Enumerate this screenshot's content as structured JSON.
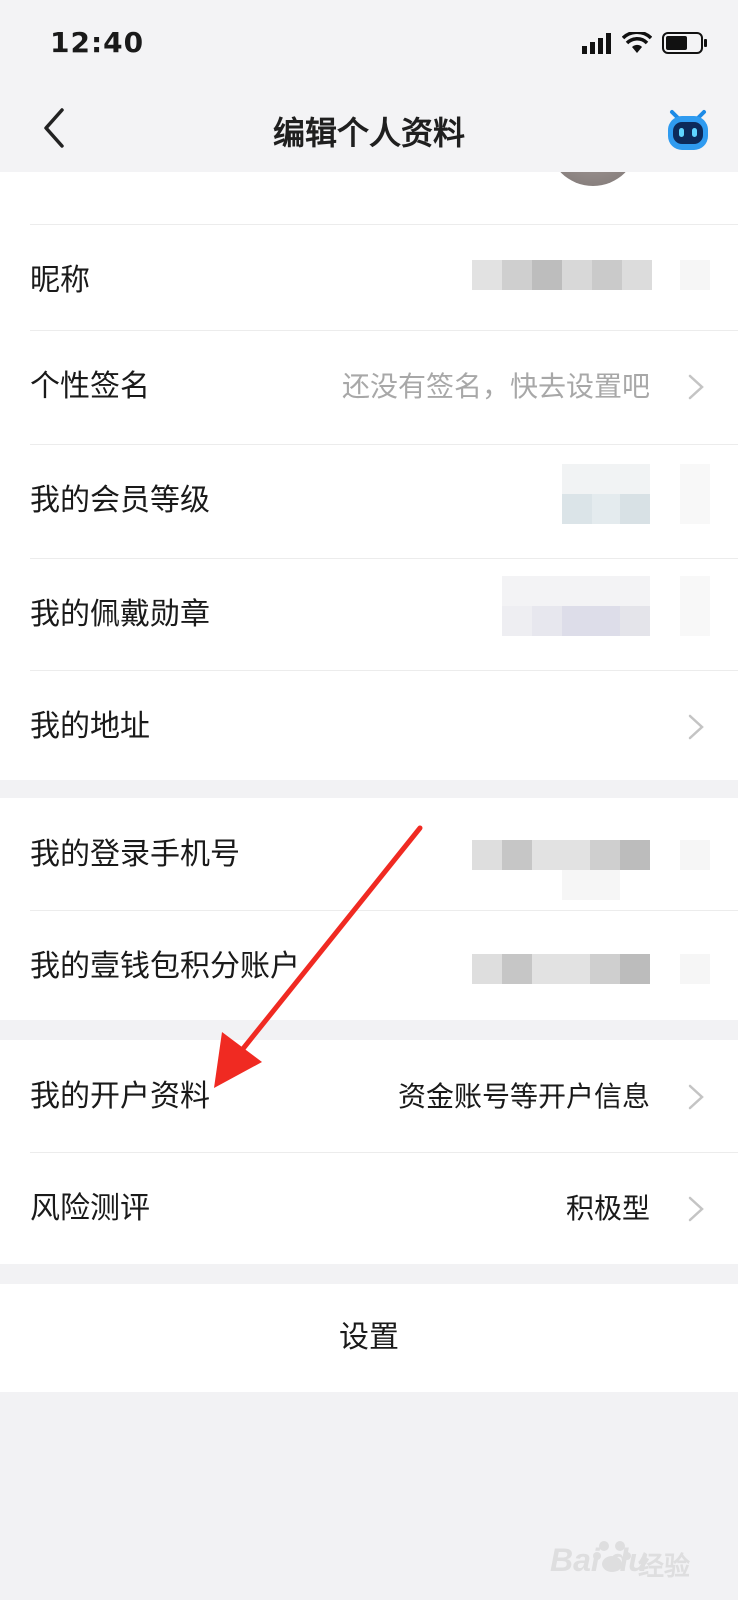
{
  "status_bar": {
    "time": "12:40"
  },
  "nav": {
    "title": "编辑个人资料"
  },
  "section1": {
    "rows": [
      {
        "label": "昵称",
        "value": ""
      },
      {
        "label": "个性签名",
        "value": "还没有签名，快去设置吧"
      },
      {
        "label": "我的会员等级",
        "value": ""
      },
      {
        "label": "我的佩戴勋章",
        "value": ""
      },
      {
        "label": "我的地址",
        "value": ""
      }
    ]
  },
  "section2": {
    "rows": [
      {
        "label": "我的登录手机号",
        "value": ""
      },
      {
        "label": "我的壹钱包积分账户",
        "value": ""
      }
    ]
  },
  "section3": {
    "rows": [
      {
        "label": "我的开户资料",
        "value": "资金账号等开户信息"
      },
      {
        "label": "风险测评",
        "value": "积极型"
      }
    ]
  },
  "settings": {
    "label": "设置"
  },
  "watermark": {
    "brand": "Bai du",
    "suffix": "经验"
  },
  "colors": {
    "background": "#f2f2f4",
    "card": "#ffffff",
    "accent_arrow": "#f02a22",
    "muted_text": "#a8a8a8"
  }
}
